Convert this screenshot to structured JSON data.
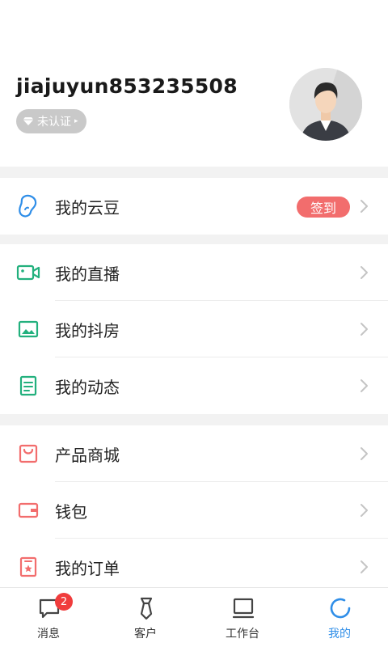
{
  "profile": {
    "username": "jiajuyun853235508",
    "cert_label": "未认证",
    "cert_arrow": "▸"
  },
  "groups": {
    "beans": {
      "label": "我的云豆",
      "sign_in": "签到"
    },
    "media": [
      {
        "label": "我的直播"
      },
      {
        "label": "我的抖房"
      },
      {
        "label": "我的动态"
      }
    ],
    "commerce": [
      {
        "label": "产品商城"
      },
      {
        "label": "钱包"
      },
      {
        "label": "我的订单"
      }
    ]
  },
  "tabbar": {
    "messages": {
      "label": "消息",
      "badge": "2"
    },
    "clients": {
      "label": "客户"
    },
    "workbench": {
      "label": "工作台"
    },
    "mine": {
      "label": "我的"
    }
  },
  "colors": {
    "accent": "#2f8ee8",
    "green": "#22b07d",
    "red": "#f26d6d",
    "badge_red": "#f03c3c"
  }
}
